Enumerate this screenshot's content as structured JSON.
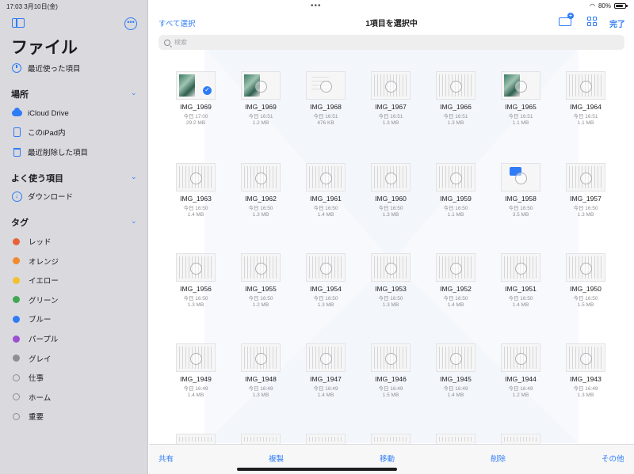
{
  "status_bar": {
    "time": "17:03",
    "date": "3月10日(金)",
    "battery": "80%"
  },
  "sidebar": {
    "title": "ファイル",
    "recent": "最近使った項目",
    "locations_header": "場所",
    "locations": [
      {
        "label": "iCloud Drive",
        "icon": "icloud-icon"
      },
      {
        "label": "このiPad内",
        "icon": "ipad-icon"
      },
      {
        "label": "最近削除した項目",
        "icon": "trash-icon"
      }
    ],
    "favorites_header": "よく使う項目",
    "favorites": [
      {
        "label": "ダウンロード",
        "icon": "download-icon"
      }
    ],
    "tags_header": "タグ",
    "tags": [
      {
        "label": "レッド",
        "color": "#e9613b"
      },
      {
        "label": "オレンジ",
        "color": "#f08a2a"
      },
      {
        "label": "イエロー",
        "color": "#f2c12e"
      },
      {
        "label": "グリーン",
        "color": "#3fa853"
      },
      {
        "label": "ブルー",
        "color": "#2f7cf6"
      },
      {
        "label": "パープル",
        "color": "#9b4fd1"
      },
      {
        "label": "グレイ",
        "color": "#8e8e93"
      },
      {
        "label": "仕事",
        "color": ""
      },
      {
        "label": "ホーム",
        "color": ""
      },
      {
        "label": "重要",
        "color": ""
      }
    ]
  },
  "toolbar": {
    "select_all": "すべて選択",
    "title": "1項目を選択中",
    "done": "完了"
  },
  "search": {
    "placeholder": "検索"
  },
  "files": [
    {
      "name": "IMG_1969",
      "date": "今日 17:00",
      "size": "29.2 MB",
      "kind": "photo",
      "selected": true
    },
    {
      "name": "IMG_1969",
      "date": "今日 16:51",
      "size": "1.2 MB",
      "kind": "photo",
      "selected": false
    },
    {
      "name": "IMG_1968",
      "date": "今日 16:51",
      "size": "476 KB",
      "kind": "doc",
      "selected": false
    },
    {
      "name": "IMG_1967",
      "date": "今日 16:51",
      "size": "1.3 MB",
      "kind": "text",
      "selected": false
    },
    {
      "name": "IMG_1966",
      "date": "今日 16:51",
      "size": "1.3 MB",
      "kind": "text",
      "selected": false
    },
    {
      "name": "IMG_1965",
      "date": "今日 16:51",
      "size": "1.1 MB",
      "kind": "photo",
      "selected": false
    },
    {
      "name": "IMG_1964",
      "date": "今日 16:51",
      "size": "1.1 MB",
      "kind": "text",
      "selected": false
    },
    {
      "name": "IMG_1963",
      "date": "今日 16:50",
      "size": "1.4 MB",
      "kind": "text",
      "selected": false
    },
    {
      "name": "IMG_1962",
      "date": "今日 16:50",
      "size": "1.3 MB",
      "kind": "text",
      "selected": false
    },
    {
      "name": "IMG_1961",
      "date": "今日 16:50",
      "size": "1.4 MB",
      "kind": "text",
      "selected": false
    },
    {
      "name": "IMG_1960",
      "date": "今日 16:50",
      "size": "1.3 MB",
      "kind": "text",
      "selected": false
    },
    {
      "name": "IMG_1959",
      "date": "今日 16:50",
      "size": "1.1 MB",
      "kind": "text",
      "selected": false
    },
    {
      "name": "IMG_1958",
      "date": "今日 16:50",
      "size": "3.5 MB",
      "kind": "blue",
      "selected": false
    },
    {
      "name": "IMG_1957",
      "date": "今日 16:50",
      "size": "1.3 MB",
      "kind": "text",
      "selected": false
    },
    {
      "name": "IMG_1956",
      "date": "今日 16:50",
      "size": "1.3 MB",
      "kind": "text",
      "selected": false
    },
    {
      "name": "IMG_1955",
      "date": "今日 16:50",
      "size": "1.2 MB",
      "kind": "text",
      "selected": false
    },
    {
      "name": "IMG_1954",
      "date": "今日 16:50",
      "size": "1.3 MB",
      "kind": "text",
      "selected": false
    },
    {
      "name": "IMG_1953",
      "date": "今日 16:50",
      "size": "1.3 MB",
      "kind": "text",
      "selected": false
    },
    {
      "name": "IMG_1952",
      "date": "今日 16:50",
      "size": "1.4 MB",
      "kind": "text",
      "selected": false
    },
    {
      "name": "IMG_1951",
      "date": "今日 16:50",
      "size": "1.4 MB",
      "kind": "text",
      "selected": false
    },
    {
      "name": "IMG_1950",
      "date": "今日 16:50",
      "size": "1.5 MB",
      "kind": "text",
      "selected": false
    },
    {
      "name": "IMG_1949",
      "date": "今日 16:49",
      "size": "1.4 MB",
      "kind": "text",
      "selected": false
    },
    {
      "name": "IMG_1948",
      "date": "今日 16:49",
      "size": "1.3 MB",
      "kind": "text",
      "selected": false
    },
    {
      "name": "IMG_1947",
      "date": "今日 16:49",
      "size": "1.4 MB",
      "kind": "text",
      "selected": false
    },
    {
      "name": "IMG_1946",
      "date": "今日 16:49",
      "size": "1.5 MB",
      "kind": "text",
      "selected": false
    },
    {
      "name": "IMG_1945",
      "date": "今日 16:49",
      "size": "1.4 MB",
      "kind": "text",
      "selected": false
    },
    {
      "name": "IMG_1944",
      "date": "今日 16:49",
      "size": "1.2 MB",
      "kind": "text",
      "selected": false
    },
    {
      "name": "IMG_1943",
      "date": "今日 16:49",
      "size": "1.3 MB",
      "kind": "text",
      "selected": false
    }
  ],
  "bottom_bar": {
    "share": "共有",
    "duplicate": "複製",
    "move": "移動",
    "delete": "削除",
    "more": "その他"
  }
}
